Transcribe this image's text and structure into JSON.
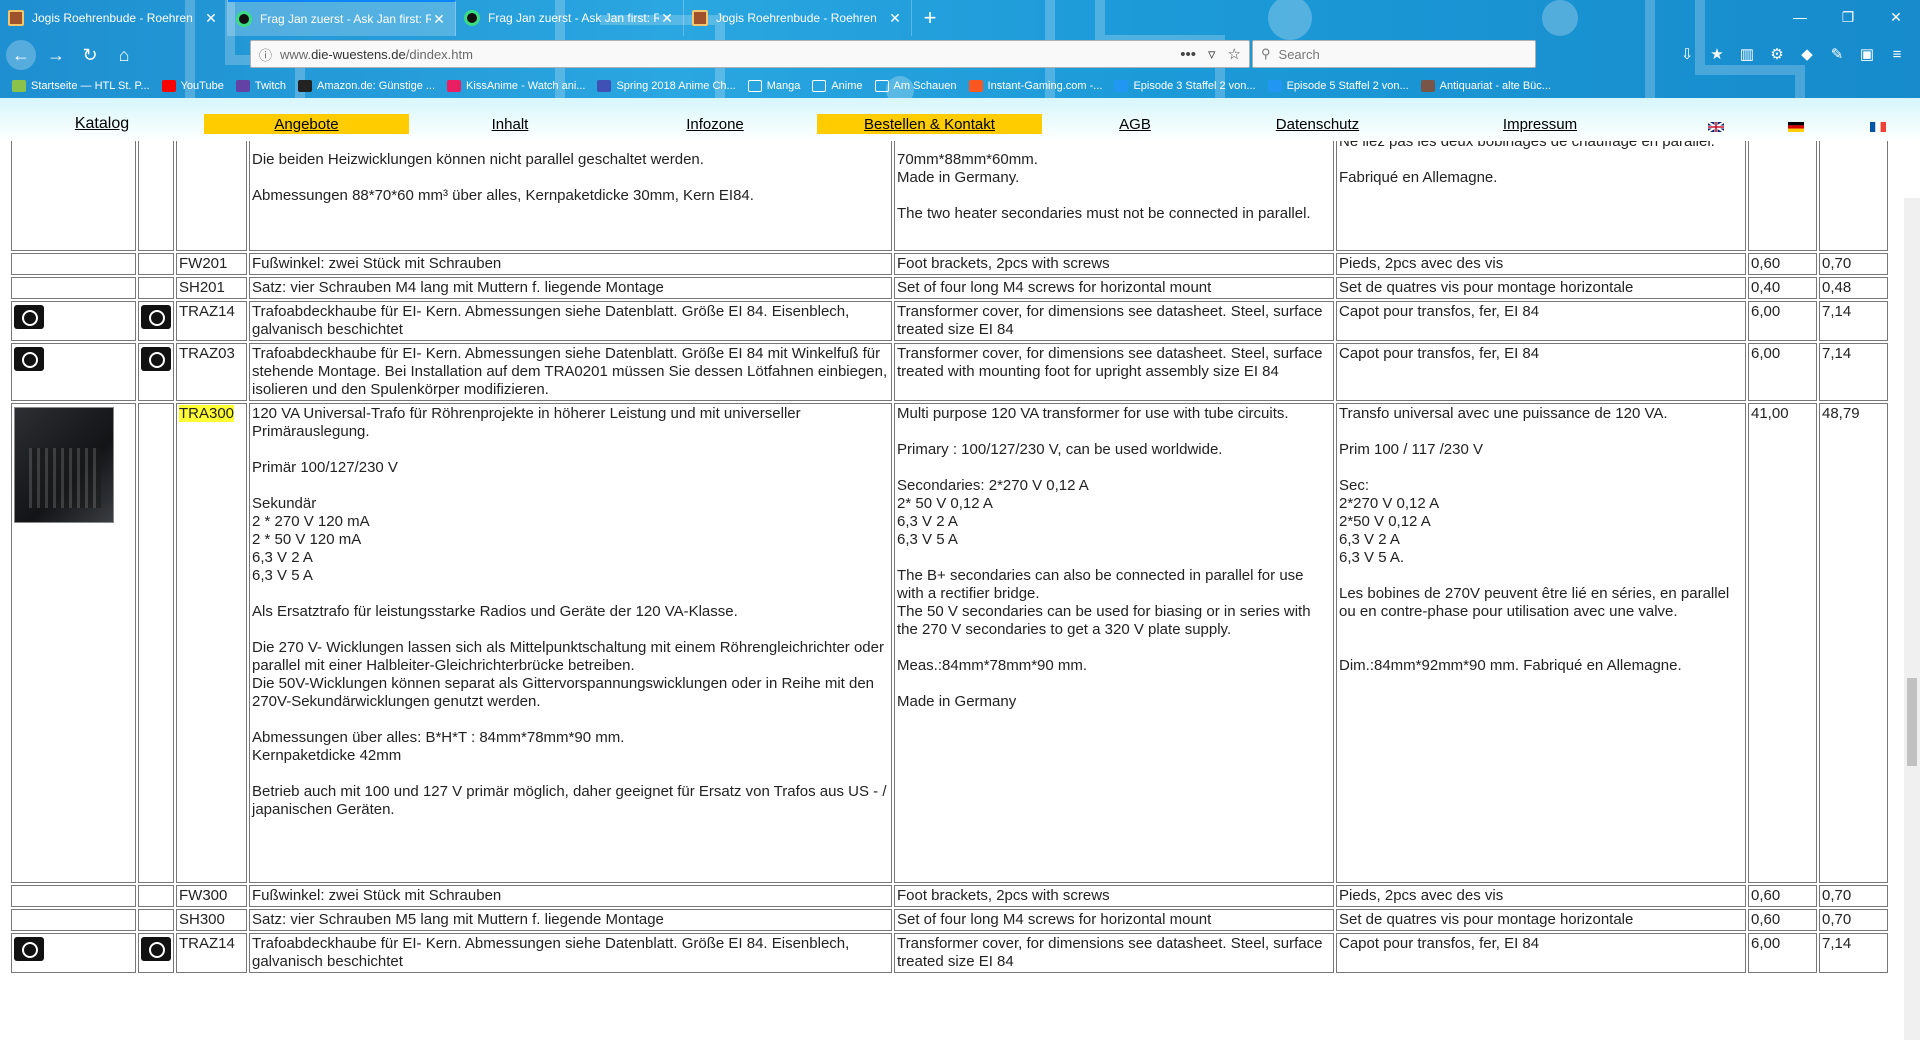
{
  "browser": {
    "tabs": [
      {
        "title": "Jogis Roehrenbude - Roehren",
        "icon": "bude-favicon",
        "active": false
      },
      {
        "title": "Frag Jan zuerst - Ask Jan first: R",
        "icon": "askjan-favicon",
        "active": true
      },
      {
        "title": "Frag Jan zuerst - Ask Jan first: R",
        "icon": "askjan-favicon",
        "active": false
      },
      {
        "title": "Jogis Roehrenbude - Roehren",
        "icon": "bude-favicon",
        "active": false
      }
    ],
    "new_tab_label": "+",
    "url_prefix": "www.",
    "url_domain": "die-wuestens.de",
    "url_path": "/dindex.htm",
    "search_placeholder": "Search",
    "bookmarks": [
      {
        "label": "Startseite — HTL St. P...",
        "color": "#8bc34a"
      },
      {
        "label": "YouTube",
        "color": "#ff0000"
      },
      {
        "label": "Twitch",
        "color": "#6441a5"
      },
      {
        "label": "Amazon.de: Günstige ...",
        "color": "#222222"
      },
      {
        "label": "KissAnime - Watch ani...",
        "color": "#e91e63"
      },
      {
        "label": "Spring 2018 Anime Ch...",
        "color": "#3f51b5"
      },
      {
        "label": "Manga",
        "color": "#ffffff"
      },
      {
        "label": "Anime",
        "color": "#ffffff"
      },
      {
        "label": "Am Schauen",
        "color": "#ffffff"
      },
      {
        "label": "Instant-Gaming.com -...",
        "color": "#ff5722"
      },
      {
        "label": "Episode 3 Staffel 2 von...",
        "color": "#2196f3"
      },
      {
        "label": "Episode 5 Staffel 2 von...",
        "color": "#2196f3"
      },
      {
        "label": "Antiquariat - alte Büc...",
        "color": "#795548"
      }
    ]
  },
  "sitenav": {
    "items": [
      "Katalog",
      "Angebote",
      "Inhalt",
      "Infozone",
      "Bestellen & Kontakt",
      "AGB",
      "Datenschutz",
      "Impressum"
    ],
    "highlight_color": "#ffcc00"
  },
  "rows": [
    {
      "pic": "",
      "pic2": "",
      "code": "",
      "de": "\n\nDie beiden Heizwicklungen können nicht parallel geschaltet werden.\n\nAbmessungen 88*70*60 mm³ über alles, Kernpaketdicke 30mm, Kern EI84.",
      "en": "\n\n70mm*88mm*60mm.\nMade in Germany.\n\nThe two heater secondaries must not be connected in parallel.",
      "fr": "\nNe liez pas les deux bobinages de chauffage en parallel.\n\nFabriqué en Allemagne.",
      "p1": "",
      "p2": ""
    },
    {
      "pic": "",
      "pic2": "",
      "code": "FW201",
      "de": "Fußwinkel: zwei Stück mit Schrauben",
      "en": "Foot brackets, 2pcs with screws",
      "fr": "Pieds, 2pcs avec des vis",
      "p1": "0,60",
      "p2": "0,70"
    },
    {
      "pic": "",
      "pic2": "",
      "code": "SH201",
      "de": "Satz: vier Schrauben M4 lang mit Muttern f. liegende Montage",
      "en": "Set of four long M4 screws for horizontal mount",
      "fr": "Set de quatres vis pour montage horizontale",
      "p1": "0,40",
      "p2": "0,48"
    },
    {
      "pic": "camera",
      "pic2": "camera",
      "code": "TRAZ14",
      "de": "Trafoabdeckhaube für EI- Kern. Abmessungen siehe Datenblatt. Größe EI 84. Eisenblech, galvanisch beschichtet",
      "en": "Transformer cover, for dimensions see datasheet. Steel, surface treated size EI 84",
      "fr": "Capot pour transfos, fer, EI 84",
      "p1": "6,00",
      "p2": "7,14"
    },
    {
      "pic": "camera",
      "pic2": "camera",
      "code": "TRAZ03",
      "de": "Trafoabdeckhaube für EI- Kern. Abmessungen siehe Datenblatt. Größe EI 84 mit Winkelfuß für stehende Montage. Bei Installation auf dem TRA0201 müssen Sie dessen Lötfahnen einbiegen, isolieren und den Spulenkörper modifizieren.",
      "en": "Transformer cover, for dimensions see datasheet. Steel, surface treated with mounting foot for upright assembly size EI 84",
      "fr": "Capot pour transfos, fer, EI 84",
      "p1": "6,00",
      "p2": "7,14"
    },
    {
      "pic": "photo",
      "pic2": "",
      "code": "TRA300",
      "code_highlight": true,
      "de": "120 VA Universal-Trafo für Röhrenprojekte in höherer Leistung und mit universeller Primärauslegung.\n\nPrimär 100/127/230 V\n\nSekundär\n2 * 270 V 120 mA\n2 * 50 V 120 mA\n6,3 V 2 A\n6,3 V 5 A\n\nAls Ersatztrafo für leistungsstarke Radios und Geräte der 120 VA-Klasse.\n\nDie 270 V- Wicklungen lassen sich als Mittelpunktschaltung mit einem Röhrengleichrichter oder parallel mit einer Halbleiter-Gleichrichterbrücke betreiben.\nDie 50V-Wicklungen können separat als Gittervorspannungswicklungen oder in Reihe mit den 270V-Sekundärwicklungen genutzt werden.\n\nAbmessungen über alles: B*H*T : 84mm*78mm*90 mm.\nKernpaketdicke 42mm\n\nBetrieb auch mit 100 und 127 V primär möglich, daher geeignet für Ersatz von Trafos aus US - / japanischen Geräten.\n\n\n",
      "en": "Multi purpose 120 VA transformer for use with tube circuits.\n\nPrimary : 100/127/230 V, can be used worldwide.\n\nSecondaries: 2*270 V 0,12 A\n2* 50 V 0,12 A\n6,3 V 2 A\n6,3 V 5 A\n\nThe B+ secondaries can also be connected in parallel for use with a rectifier bridge.\nThe 50 V secondaries can be used for biasing or in series with the 270 V secondaries to get a 320 V plate supply.\n\nMeas.:84mm*78mm*90 mm.\n\nMade in Germany",
      "fr": "Transfo universal avec une puissance de 120 VA.\n\nPrim 100 / 117 /230 V\n\nSec:\n2*270 V 0,12 A\n2*50 V 0,12 A\n6,3 V 2 A\n6,3 V 5 A.\n\nLes bobines de 270V peuvent être lié en séries, en parallel ou en contre-phase pour utilisation avec une valve.\n\n\nDim.:84mm*92mm*90 mm. Fabriqué en Allemagne.",
      "p1": "41,00",
      "p2": "48,79"
    },
    {
      "pic": "",
      "pic2": "",
      "code": "FW300",
      "de": "Fußwinkel: zwei Stück mit Schrauben",
      "en": "Foot brackets, 2pcs with screws",
      "fr": "Pieds, 2pcs avec des vis",
      "p1": "0,60",
      "p2": "0,70"
    },
    {
      "pic": "",
      "pic2": "",
      "code": "SH300",
      "de": "Satz: vier Schrauben M5 lang mit Muttern f. liegende Montage",
      "en": "Set of four long M4 screws for horizontal mount",
      "fr": "Set de quatres vis pour montage horizontale",
      "p1": "0,60",
      "p2": "0,70"
    },
    {
      "pic": "camera",
      "pic2": "camera",
      "code": "TRAZ14",
      "de": "Trafoabdeckhaube für EI- Kern. Abmessungen siehe Datenblatt. Größe EI 84. Eisenblech, galvanisch beschichtet",
      "en": "Transformer cover, for dimensions see datasheet. Steel, surface treated size EI 84",
      "fr": "Capot pour transfos, fer, EI 84",
      "p1": "6,00",
      "p2": "7,14"
    }
  ]
}
